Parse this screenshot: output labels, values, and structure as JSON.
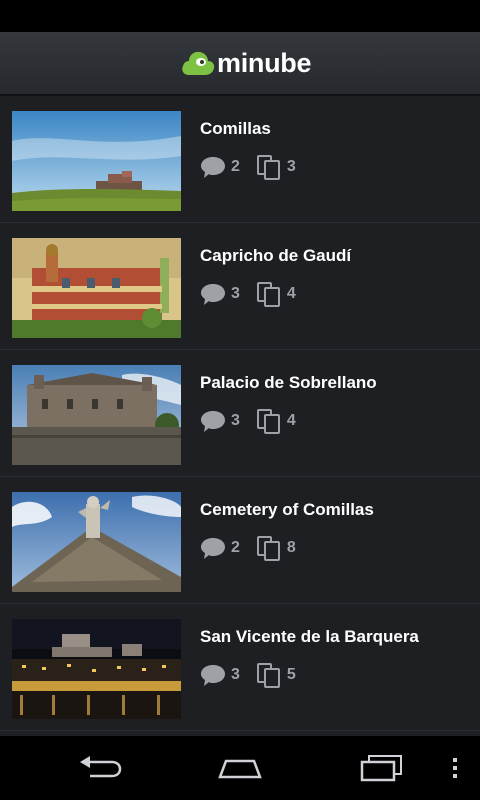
{
  "app": {
    "logo_text": "minube"
  },
  "items": [
    {
      "title": "Comillas",
      "comments": "2",
      "photos": "3"
    },
    {
      "title": "Capricho de Gaudí",
      "comments": "3",
      "photos": "4"
    },
    {
      "title": "Palacio de Sobrellano",
      "comments": "3",
      "photos": "4"
    },
    {
      "title": "Cemetery of Comillas",
      "comments": "2",
      "photos": "8"
    },
    {
      "title": "San Vicente de la Barquera",
      "comments": "3",
      "photos": "5"
    }
  ],
  "icons": {
    "comment": "comment-icon",
    "photos": "photos-icon",
    "nav_back": "back-icon",
    "nav_home": "home-icon",
    "nav_recent": "recent-apps-icon",
    "nav_menu": "overflow-menu-icon"
  },
  "colors": {
    "brand_green": "#7dc243",
    "background": "#1d1f22",
    "stat_gray": "#9ea1a5"
  }
}
